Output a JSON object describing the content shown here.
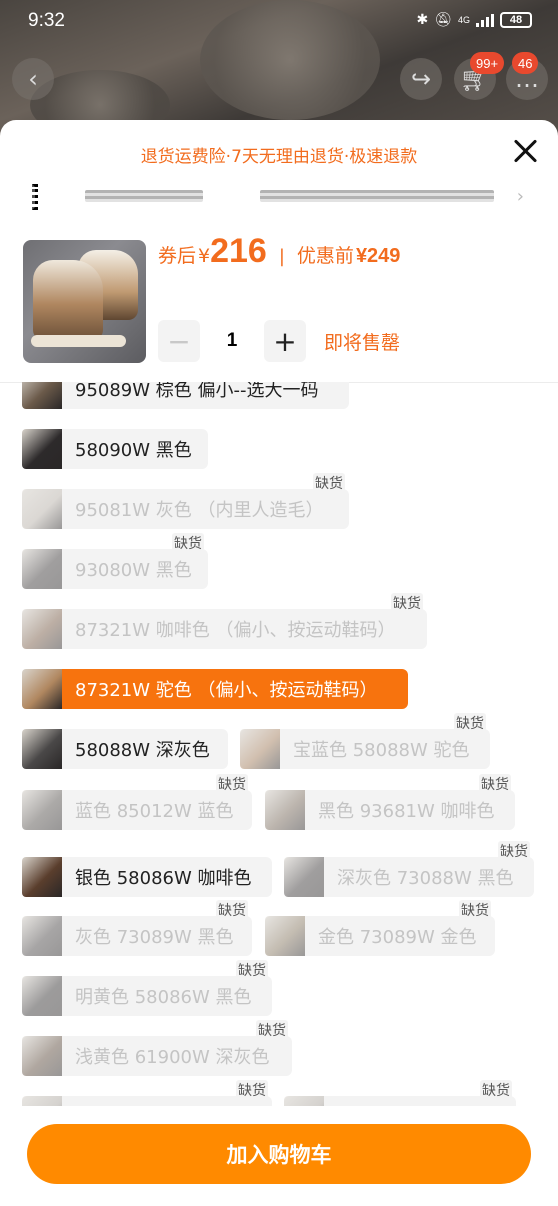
{
  "status_bar": {
    "time": "9:32",
    "network": "4G",
    "battery": "48"
  },
  "top_nav": {
    "cart_badge": "99+",
    "message_badge": "46"
  },
  "sheet": {
    "promo_text": "退货运费险·7天无理由退货·极速退款",
    "price_label": "券后",
    "currency": "¥",
    "price": "216",
    "original_label": "优惠前",
    "original_price": "¥249",
    "quantity": "1",
    "stock_status": "即将售罄"
  },
  "variants": [
    {
      "label": "95089W 棕色 偏小--选大一码",
      "state": "available",
      "oos": "",
      "thumb_color": "#6b5a4a"
    },
    {
      "label": "58090W 黑色",
      "state": "available",
      "oos": "",
      "thumb_color": "#2d2a2b"
    },
    {
      "label": "95081W 灰色 （内里人造毛）",
      "state": "disabled",
      "oos": "缺货",
      "thumb_color": "#bdb6ad"
    },
    {
      "label": "93080W 黑色",
      "state": "disabled",
      "oos": "缺货",
      "thumb_color": "#3b3737"
    },
    {
      "label": "87321W 咖啡色 （偏小、按运动鞋码）",
      "state": "disabled",
      "oos": "缺货",
      "thumb_color": "#7a5c45"
    },
    {
      "label": "87321W 驼色 （偏小、按运动鞋码）",
      "state": "selected",
      "oos": "",
      "thumb_color": "#b08760"
    },
    {
      "label": "58088W 深灰色",
      "state": "available",
      "oos": "",
      "thumb_color": "#4a4848"
    },
    {
      "label": "宝蓝色 58088W 驼色",
      "state": "disabled",
      "oos": "缺货",
      "thumb_color": "#a8805c"
    },
    {
      "label": "蓝色 85012W 蓝色",
      "state": "disabled",
      "oos": "缺货",
      "thumb_color": "#55504c"
    },
    {
      "label": "黑色 93681W 咖啡色",
      "state": "disabled",
      "oos": "缺货",
      "thumb_color": "#7a6a5a"
    },
    {
      "label": "银色 58086W 咖啡色",
      "state": "available",
      "oos": "",
      "thumb_color": "#5a3e2d"
    },
    {
      "label": "深灰色 73088W 黑色",
      "state": "disabled",
      "oos": "缺货",
      "thumb_color": "#3a3636"
    },
    {
      "label": "灰色 73089W 黑色",
      "state": "disabled",
      "oos": "缺货",
      "thumb_color": "#4a4646"
    },
    {
      "label": "金色 73089W 金色",
      "state": "disabled",
      "oos": "缺货",
      "thumb_color": "#8a7a62"
    },
    {
      "label": "明黄色 58086W 黑色",
      "state": "disabled",
      "oos": "缺货",
      "thumb_color": "#333030"
    },
    {
      "label": "浅黄色 61900W 深灰色",
      "state": "disabled",
      "oos": "缺货",
      "thumb_color": "#5d4a3a"
    },
    {
      "label": "",
      "state": "disabled",
      "oos": "缺货",
      "thumb_color": "#b0aaa2"
    },
    {
      "label": "",
      "state": "disabled",
      "oos": "缺货",
      "thumb_color": "#b0aaa2"
    }
  ],
  "cta": {
    "label": "加入购物车"
  }
}
